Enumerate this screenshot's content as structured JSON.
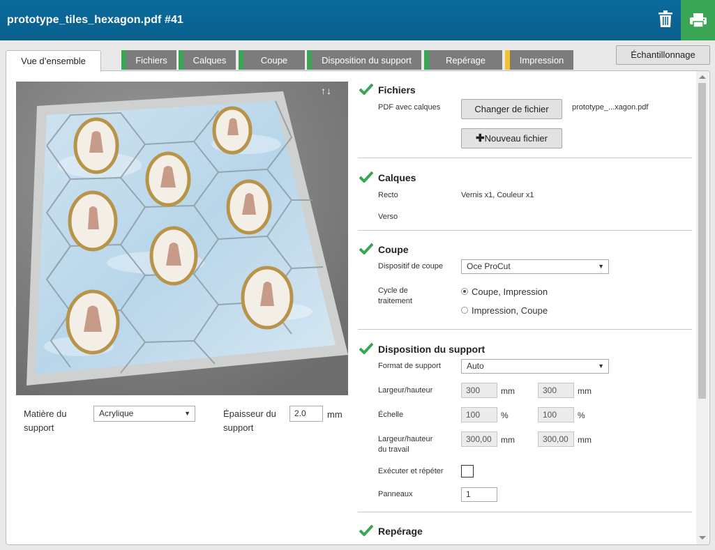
{
  "header": {
    "title": "prototype_tiles_hexagon.pdf #41",
    "brand_color": "#0b6b9c",
    "print_color": "#3aa655"
  },
  "tabs": {
    "active": "Vue d’ensemble",
    "items": [
      {
        "label": "Fichiers",
        "status_color": "#3aa655"
      },
      {
        "label": "Calques",
        "status_color": "#3aa655"
      },
      {
        "label": "Coupe",
        "status_color": "#3aa655"
      },
      {
        "label": "Disposition du support",
        "status_color": "#3aa655"
      },
      {
        "label": "Repérage",
        "status_color": "#3aa655"
      },
      {
        "label": "Impression",
        "status_color": "#f2c230"
      }
    ],
    "sample_button": "Échantillonnage"
  },
  "preview": {
    "material_label": "Matière du support",
    "material_value": "Acrylique",
    "thickness_label": "Épaisseur du support",
    "thickness_value": "2.0",
    "thickness_unit": "mm"
  },
  "fichiers": {
    "title": "Fichiers",
    "pdf_label": "PDF avec calques",
    "change_button": "Changer de fichier",
    "filename": "prototype_...xagon.pdf",
    "new_button": "Nouveau fichier"
  },
  "calques": {
    "title": "Calques",
    "recto_label": "Recto",
    "recto_value": "Vernis x1, Couleur x1",
    "verso_label": "Verso"
  },
  "coupe": {
    "title": "Coupe",
    "device_label": "Dispositif de coupe",
    "device_value": "Oce ProCut",
    "cycle_label_1": "Cycle de",
    "cycle_label_2": "traitement",
    "option_1": "Coupe, Impression",
    "option_2": "Impression, Coupe"
  },
  "disposition": {
    "title": "Disposition du support",
    "format_label": "Format de support",
    "format_value": "Auto",
    "size_label": "Largeur/hauteur",
    "width": "300",
    "height": "300",
    "mm": "mm",
    "scale_label": "Échelle",
    "scale_x": "100",
    "scale_y": "100",
    "percent": "%",
    "job_label_1": "Largeur/hauteur",
    "job_label_2": "du travail",
    "job_width": "300,00",
    "job_height": "300,00",
    "repeat_label": "Exécuter et répéter",
    "panels_label": "Panneaux",
    "panels_value": "1"
  },
  "reperage": {
    "title": "Repérage"
  }
}
